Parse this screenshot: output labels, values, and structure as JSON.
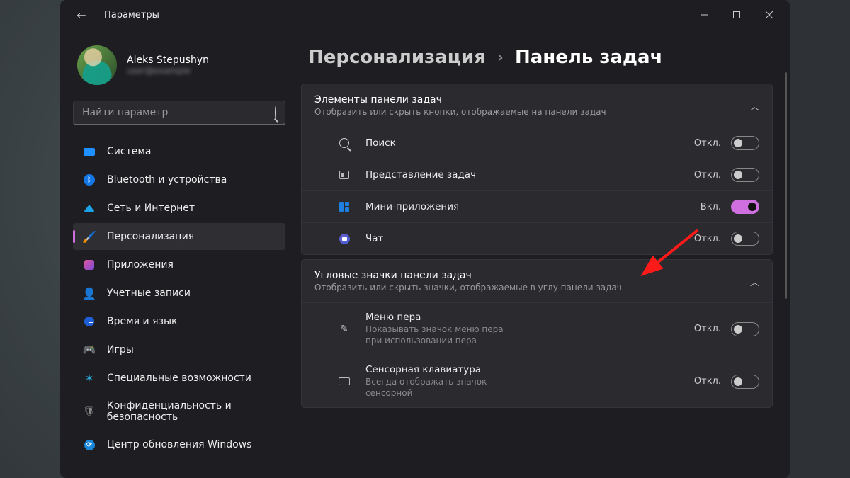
{
  "window": {
    "title": "Параметры"
  },
  "profile": {
    "name": "Aleks Stepushyn",
    "email": "user@example"
  },
  "search": {
    "placeholder": "Найти параметр"
  },
  "sidebar": {
    "items": [
      {
        "label": "Система"
      },
      {
        "label": "Bluetooth и устройства"
      },
      {
        "label": "Сеть и Интернет"
      },
      {
        "label": "Персонализация"
      },
      {
        "label": "Приложения"
      },
      {
        "label": "Учетные записи"
      },
      {
        "label": "Время и язык"
      },
      {
        "label": "Игры"
      },
      {
        "label": "Специальные возможности"
      },
      {
        "label": "Конфиденциальность и безопасность"
      },
      {
        "label": "Центр обновления Windows"
      }
    ]
  },
  "breadcrumb": {
    "parent": "Персонализация",
    "current": "Панель задач"
  },
  "sections": [
    {
      "title": "Элементы панели задач",
      "subtitle": "Отобразить или скрыть кнопки, отображаемые на панели задач",
      "items": [
        {
          "label": "Поиск",
          "state": "Откл.",
          "on": false
        },
        {
          "label": "Представление задач",
          "state": "Откл.",
          "on": false
        },
        {
          "label": "Мини-приложения",
          "state": "Вкл.",
          "on": true
        },
        {
          "label": "Чат",
          "state": "Откл.",
          "on": false
        }
      ]
    },
    {
      "title": "Угловые значки панели задач",
      "subtitle": "Отобразить или скрыть значки, отображаемые в углу панели задач",
      "items": [
        {
          "label": "Меню пера",
          "sub": "Показывать значок меню пера при использовании пера",
          "state": "Откл.",
          "on": false
        },
        {
          "label": "Сенсорная клавиатура",
          "sub": "Всегда отображать значок сенсорной",
          "state": "Откл.",
          "on": false
        }
      ]
    }
  ]
}
